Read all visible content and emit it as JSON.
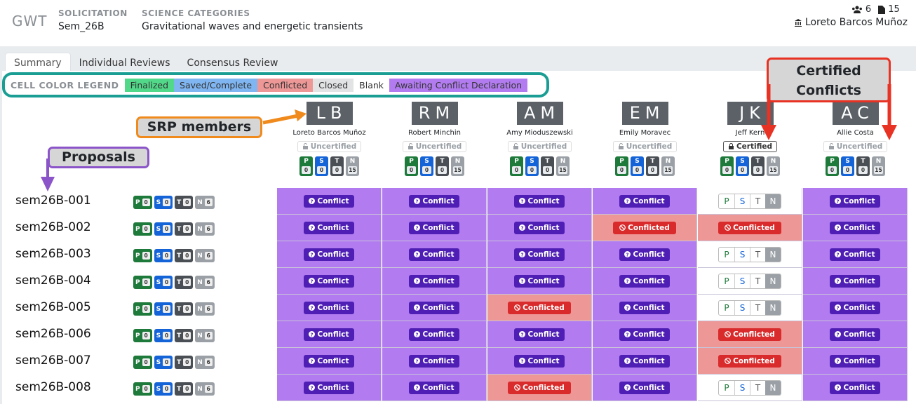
{
  "header": {
    "brand": "GWT",
    "solicitation_caption": "SOLICITATION",
    "solicitation_value": "Sem_26B",
    "science_caption": "SCIENCE CATEGORIES",
    "science_value": "Gravitational waves and energetic transients",
    "reviewers_count": "6",
    "docs_count": "15",
    "user_name": "Loreto Barcos Muñoz"
  },
  "tabs": [
    "Summary",
    "Individual Reviews",
    "Consensus Review"
  ],
  "legend": {
    "title": "CELL COLOR LEGEND",
    "items": [
      {
        "label": "Finalized",
        "color": "#52d889"
      },
      {
        "label": "Saved/Complete",
        "color": "#7fb5f0"
      },
      {
        "label": "Conflicted",
        "color": "#ee9797"
      },
      {
        "label": "Closed",
        "color": "#e2e3e5"
      },
      {
        "label": "Blank",
        "color": "#ffffff"
      },
      {
        "label": "Awaiting Conflict Declaration",
        "color": "#b27cf0"
      }
    ]
  },
  "callouts": {
    "srp": "SRP members",
    "proposals": "Proposals",
    "certified_line1": "Certified",
    "certified_line2": "Conflicts"
  },
  "members": [
    {
      "initials": "LB",
      "name": "Loreto Barcos Muñoz",
      "status": "Uncertified",
      "p": "0",
      "s": "0",
      "t": "0",
      "n": "15"
    },
    {
      "initials": "RM",
      "name": "Robert Minchin",
      "status": "Uncertified",
      "p": "0",
      "s": "0",
      "t": "0",
      "n": "15"
    },
    {
      "initials": "AM",
      "name": "Amy Mioduszewski",
      "status": "Uncertified",
      "p": "0",
      "s": "0",
      "t": "0",
      "n": "15"
    },
    {
      "initials": "EM",
      "name": "Emily Moravec",
      "status": "Uncertified",
      "p": "0",
      "s": "0",
      "t": "0",
      "n": "15"
    },
    {
      "initials": "JK",
      "name": "Jeff Kern",
      "status": "Certified",
      "p": "0",
      "s": "0",
      "t": "0",
      "n": "15"
    },
    {
      "initials": "AC",
      "name": "Allie Costa",
      "status": "Uncertified",
      "p": "0",
      "s": "0",
      "t": "0",
      "n": "15"
    }
  ],
  "labels": {
    "conflict": "Conflict",
    "conflicted": "Conflicted",
    "p": "P",
    "s": "S",
    "t": "T",
    "n": "N"
  },
  "proposals": [
    {
      "id": "sem26B-001",
      "p": "0",
      "s": "0",
      "t": "0",
      "n": "6",
      "cells": [
        "conflict",
        "conflict",
        "conflict",
        "conflict",
        "pstn",
        "conflict"
      ]
    },
    {
      "id": "sem26B-002",
      "p": "0",
      "s": "0",
      "t": "0",
      "n": "6",
      "cells": [
        "conflict",
        "conflict",
        "conflict",
        "conflicted",
        "conflicted",
        "conflict"
      ]
    },
    {
      "id": "sem26B-003",
      "p": "0",
      "s": "0",
      "t": "0",
      "n": "6",
      "cells": [
        "conflict",
        "conflict",
        "conflict",
        "conflict",
        "pstn",
        "conflict"
      ]
    },
    {
      "id": "sem26B-004",
      "p": "0",
      "s": "0",
      "t": "0",
      "n": "6",
      "cells": [
        "conflict",
        "conflict",
        "conflict",
        "conflict",
        "pstn",
        "conflict"
      ]
    },
    {
      "id": "sem26B-005",
      "p": "0",
      "s": "0",
      "t": "0",
      "n": "6",
      "cells": [
        "conflict",
        "conflict",
        "conflicted",
        "conflict",
        "pstn",
        "conflict"
      ]
    },
    {
      "id": "sem26B-006",
      "p": "0",
      "s": "0",
      "t": "0",
      "n": "6",
      "cells": [
        "conflict",
        "conflict",
        "conflict",
        "conflict",
        "conflicted",
        "conflict"
      ]
    },
    {
      "id": "sem26B-007",
      "p": "0",
      "s": "0",
      "t": "0",
      "n": "6",
      "cells": [
        "conflict",
        "conflict",
        "conflict",
        "conflict",
        "conflicted",
        "conflict"
      ]
    },
    {
      "id": "sem26B-008",
      "p": "0",
      "s": "0",
      "t": "0",
      "n": "6",
      "cells": [
        "conflict",
        "conflict",
        "conflicted",
        "conflict",
        "pstn",
        "conflict"
      ]
    }
  ]
}
